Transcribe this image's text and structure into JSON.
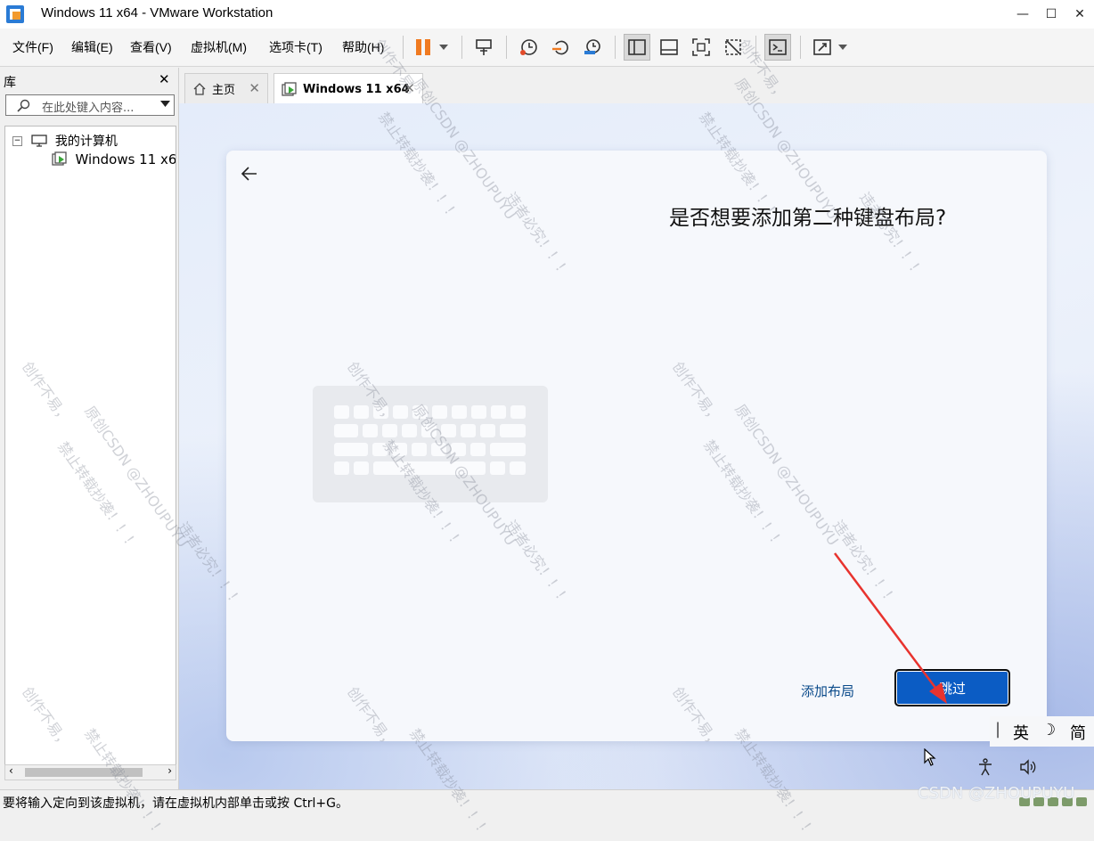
{
  "window": {
    "title": "Windows 11 x64 - VMware Workstation"
  },
  "menu": [
    "文件(F)",
    "编辑(E)",
    "查看(V)",
    "虚拟机(M)",
    "选项卡(T)",
    "帮助(H)"
  ],
  "library": {
    "header": "库",
    "search_placeholder": "在此处键入内容...",
    "tree": {
      "root": "我的计算机",
      "child": "Windows 11 x64"
    }
  },
  "tabs": [
    {
      "label": "主页"
    },
    {
      "label": "Windows 11 x64"
    }
  ],
  "oobe": {
    "title": "是否想要添加第二种键盘布局?",
    "add_layout": "添加布局",
    "skip": "跳过"
  },
  "ime": {
    "lang": "英",
    "mode": "简"
  },
  "statusbar": {
    "text": "要将输入定向到该虚拟机，请在虚拟机内部单击或按 Ctrl+G。"
  },
  "credit": "CSDN @ZHOUPUYU",
  "watermark": {
    "a": "创作不易，",
    "b": "原创CSDN @ZHOUPUYU",
    "c": "禁止转载抄袭！！！",
    "d": "违者必究！！！"
  },
  "colors": {
    "skip_button": "#0b5cc4",
    "link": "#0a4a8a",
    "arrow": "#e8332e",
    "pause": "#f07a20"
  },
  "icons": [
    "vmware-icon",
    "pause-icon",
    "dropdown-icon",
    "send-keys-icon",
    "snapshot-icon",
    "revert-snapshot-icon",
    "snapshot-manager-icon",
    "sidebar-view-icon",
    "console-view-icon",
    "fullscreen-icon",
    "unity-icon",
    "terminal-icon",
    "stretch-icon",
    "home-icon",
    "vm-icon",
    "computer-icon",
    "back-arrow-icon",
    "keyboard-illustration",
    "accessibility-icon",
    "volume-icon"
  ]
}
